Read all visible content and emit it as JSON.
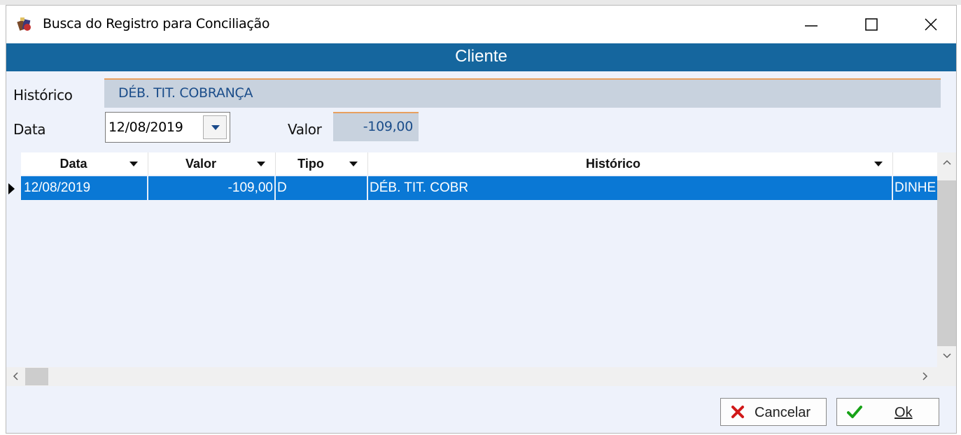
{
  "window": {
    "title": "Busca do Registro para Conciliação",
    "controls": [
      "minimize",
      "maximize",
      "close"
    ]
  },
  "banner": {
    "title": "Cliente"
  },
  "form": {
    "historico_label": "Histórico",
    "historico_value": "DÉB. TIT. COBRANÇA",
    "data_label": "Data",
    "data_value": "12/08/2019",
    "valor_label": "Valor",
    "valor_value": "-109,00"
  },
  "grid": {
    "columns": [
      "Data",
      "Valor",
      "Tipo",
      "Histórico"
    ],
    "rows": [
      {
        "data": "12/08/2019",
        "valor": "-109,00",
        "tipo": "D",
        "historico": "DÉB. TIT. COBR",
        "extra": "DINHE"
      }
    ]
  },
  "buttons": {
    "cancel_label": "Cancelar",
    "ok_label": "Ok"
  },
  "colors": {
    "banner": "#15669e",
    "selected_row": "#0a78d5",
    "readonly_field": "#c8d2de",
    "accent_border": "#e8a060"
  }
}
